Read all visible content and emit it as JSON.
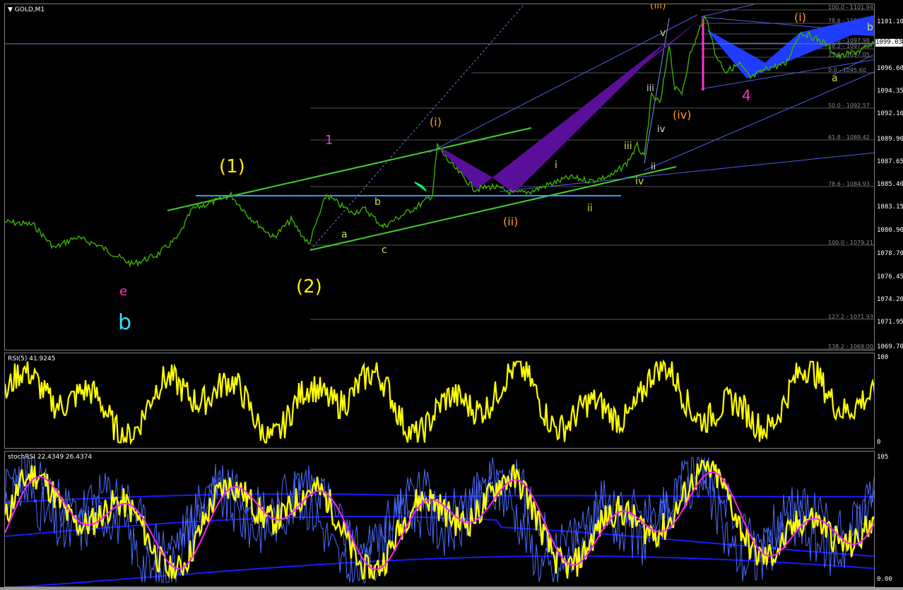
{
  "symbol_label": "GOLD,M1",
  "main_axis": {
    "ticks": [
      "1101.10",
      "1098.85",
      "1096.60",
      "1094.35",
      "1092.10",
      "1089.90",
      "1087.65",
      "1085.40",
      "1083.15",
      "1080.90",
      "1078.70",
      "1076.45",
      "1074.20",
      "1071.95",
      "1069.70"
    ],
    "current_price": "1099.03"
  },
  "fib_levels": [
    {
      "label": "100.0 - 1101.94"
    },
    {
      "label": "78.6 - 1100.94"
    },
    {
      "label": "63.8 - 1099.68"
    },
    {
      "label": "50.0 - 1097.98"
    },
    {
      "label": "38.2 - 1097.39"
    },
    {
      "label": "23.6 - 1097.05"
    },
    {
      "label": "0.0 - 1095.60"
    },
    {
      "label": "50.0 - 1092.57"
    },
    {
      "label": "61.8 - 1089.42"
    },
    {
      "label": "78.6 - 1084.93"
    },
    {
      "label": "100.0 - 1079.21"
    },
    {
      "label": "127.2 - 1071.93"
    },
    {
      "label": "138.2 - 1069.00"
    }
  ],
  "wave_labels": {
    "one_paren": "(1)",
    "two_paren": "(2)",
    "one_magenta": "1",
    "e_magenta": "e",
    "b_cyan": "b",
    "a_small": "a",
    "b_small": "b",
    "c_small": "c",
    "i_orange": "(i)",
    "ii_orange": "(ii)",
    "iii_orange": "(iii)",
    "iv_orange": "(iv)",
    "i_orange_right": "(i)",
    "i_green": "i",
    "ii_green": "ii",
    "iii_green": "iii",
    "iv_green": "iv",
    "v_green": "v",
    "ii_white": "ii",
    "iii_white": "iii",
    "iv_white": "iv",
    "four_magenta": "4",
    "a_right": "a",
    "b_right": "b"
  },
  "rsi": {
    "label": "RSI(5) 41.9245",
    "axis_top": "100",
    "axis_bottom": "0"
  },
  "stoch": {
    "label": "stochRSI 22.4349 26.4374",
    "axis_top": "105",
    "axis_bottom": "0.00"
  },
  "colors": {
    "price_bars": "#3cb000",
    "rsi_line": "#ffff00",
    "stoch_main": "#ffff00",
    "stoch_signal": "#ff20ff",
    "bands": "#1a1aff",
    "harmonic_purple": "#5a0f9a",
    "harmonic_blue": "#1f3cff",
    "trendline_green": "#44cc33",
    "support_blue": "#3399ff"
  }
}
